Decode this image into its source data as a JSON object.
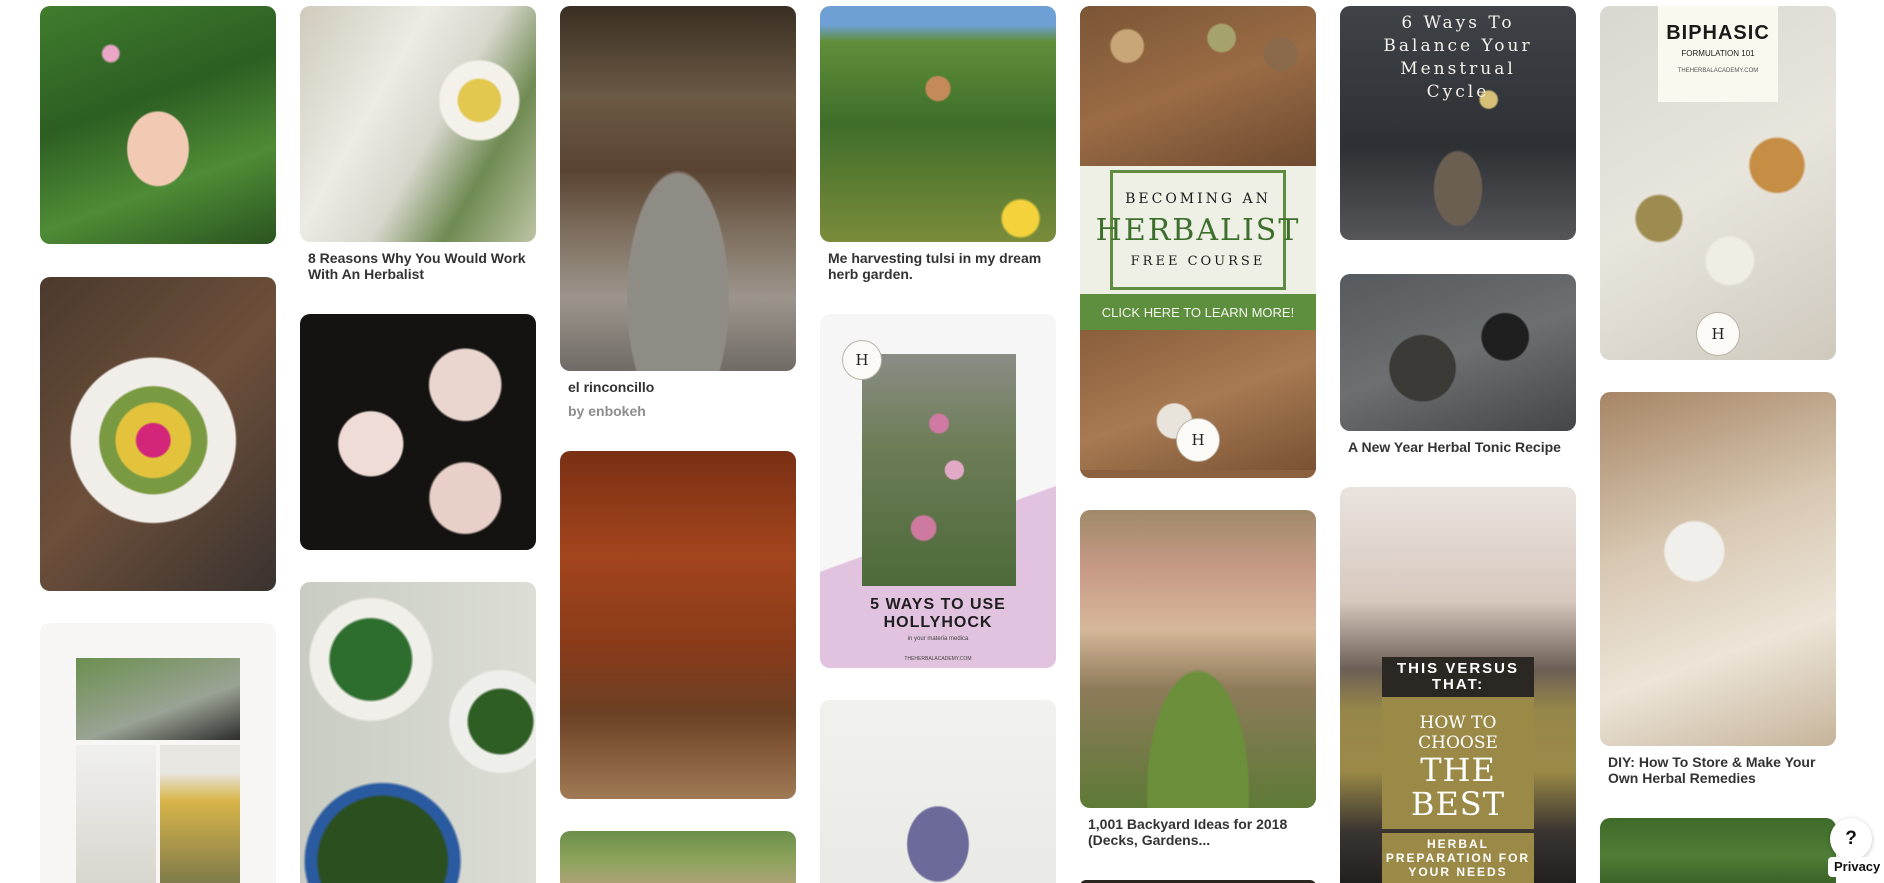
{
  "pins": {
    "p1": {
      "caption": ""
    },
    "p2": {
      "caption": "8 Reasons Why You Would Work With An Herbalist"
    },
    "p3": {
      "caption": "el rinconcillo",
      "byline": "by enbokeh"
    },
    "p4": {
      "caption": "Me harvesting tulsi in my dream herb garden."
    },
    "p5": {
      "line1": "BECOMING AN",
      "line2": "HERBALIST",
      "line3": "FREE COURSE",
      "cta": "CLICK HERE TO LEARN MORE!",
      "seal": "H"
    },
    "p6": {
      "overlay": "6 Ways To Balance Your Menstrual Cycle"
    },
    "p7": {
      "title": "BIPHASIC",
      "subtitle": "FORMULATION 101",
      "site": "THEHERBALACADEMY.COM",
      "seal": "H"
    },
    "p9": {
      "seal": "H",
      "title": "5 WAYS TO USE HOLLYHOCK",
      "subtitle": "in your materia medica",
      "site": "THEHERBALACADEMY.COM"
    },
    "p10": {
      "caption": "A New Year Herbal Tonic Recipe"
    },
    "p11": {
      "line1": "THIS VERSUS THAT:",
      "line2": "HOW TO CHOOSE",
      "line3": "THE BEST",
      "line4": "HERBAL PREPARATION FOR YOUR NEEDS"
    },
    "p12": {
      "caption": "DIY: How To Store & Make Your Own Herbal Remedies"
    },
    "p13": {
      "caption": "1,001 Backyard Ideas for 2018 (Decks, Gardens..."
    }
  },
  "controls": {
    "help_label": "?",
    "privacy_label": "Privacy"
  }
}
